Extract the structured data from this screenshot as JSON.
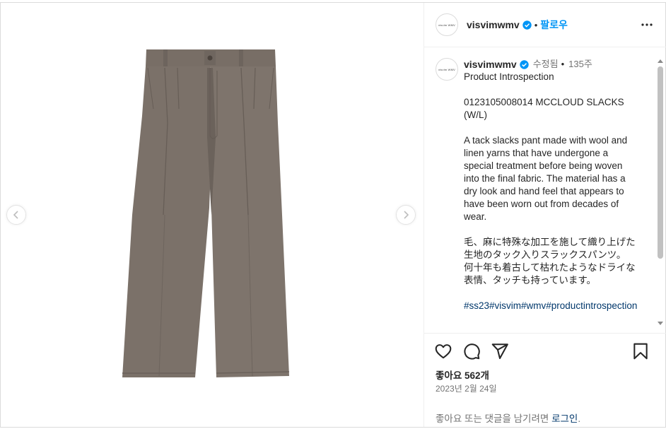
{
  "colors": {
    "link_blue": "#0095f6",
    "hashtag": "#00376b",
    "muted": "#737373",
    "verified": "#0095f6",
    "pants": "#7b7169"
  },
  "media": {
    "image_alt": "Brown-grey tack slacks pants product photo",
    "prev_icon": "chevron-left-icon",
    "next_icon": "chevron-right-icon"
  },
  "header": {
    "avatar_text": "visvim WMV",
    "username": "visvimwmv",
    "separator": "•",
    "follow_label": "팔로우",
    "more_icon": "more-horizontal-icon"
  },
  "caption": {
    "username": "visvimwmv",
    "edited": "수정됨",
    "separator": "•",
    "time": "135주",
    "title": "Product Introspection",
    "product": "0123105008014 MCCLOUD SLACKS (W/L)",
    "description_en": "A tack slacks pant made with wool and linen yarns that have undergone a special treatment before being woven into the final fabric.  The material has a dry look and hand feel that appears to have been worn out from decades of wear.",
    "description_jp_1": "毛、麻に特殊な加工を施して織り上げた生地のタック入りスラックスパンツ。",
    "description_jp_2": "何十年も着古して枯れたようなドライな表情、タッチも持っています。",
    "hashtags": "#ss23#visvim#wmv#productintrospection"
  },
  "actions": {
    "like_icon": "heart-icon",
    "comment_icon": "comment-icon",
    "share_icon": "send-icon",
    "save_icon": "bookmark-icon"
  },
  "likes": "좋아요 562개",
  "date": "2023년 2월 24일",
  "login_prompt": {
    "prefix": "좋아요 또는 댓글을 남기려면",
    "link": "로그인",
    "suffix": "."
  }
}
